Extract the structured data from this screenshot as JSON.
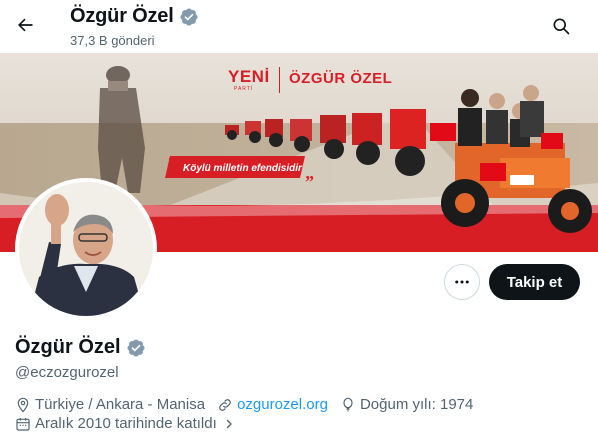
{
  "header": {
    "name": "Özgür Özel",
    "post_count": "37,3 B gönderi",
    "back_icon": "arrow-left-icon",
    "search_icon": "search-icon"
  },
  "banner": {
    "party_word": "YENİ",
    "party_sub": "PARTİ",
    "banner_name": "ÖZGÜR ÖZEL",
    "slogan": "Köylü milletin efendisidir"
  },
  "actions": {
    "follow_label": "Takip et",
    "more_icon": "more-horizontal-icon"
  },
  "profile": {
    "name": "Özgür Özel",
    "handle": "@eczozgurozel",
    "verified": true,
    "location": "Türkiye / Ankara - Manisa",
    "website": "ozgurozel.org",
    "birth": "Doğum yılı: 1974",
    "joined": "Aralık 2010 tarihinde katıldı"
  },
  "colors": {
    "verified_badge": "#829aab",
    "link": "#1d9bf0",
    "follow_bg": "#0f1419",
    "banner_red": "#d81e25"
  }
}
